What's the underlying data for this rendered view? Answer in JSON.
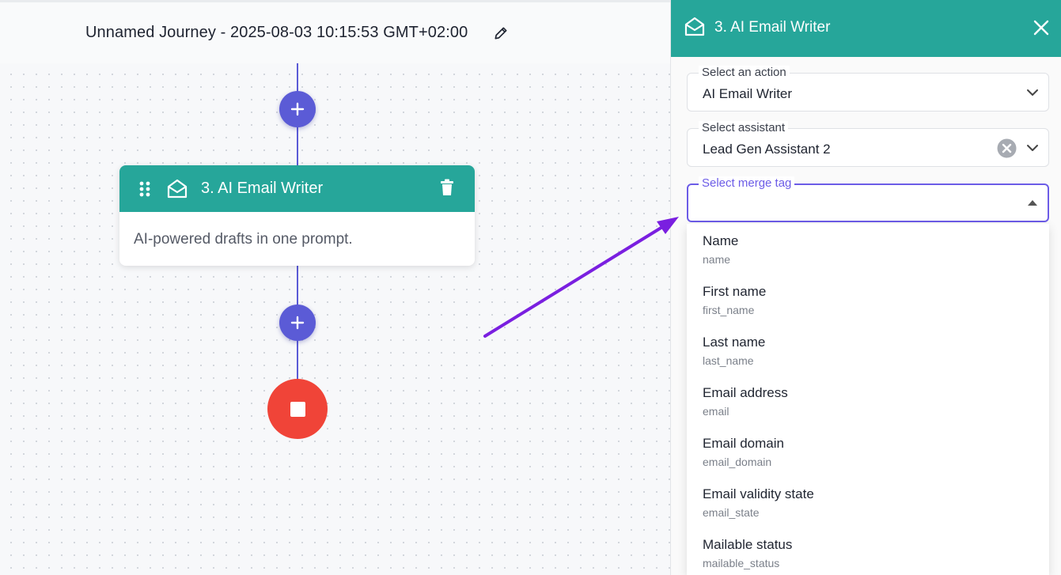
{
  "journey": {
    "title": "Unnamed Journey - 2025-08-03 10:15:53 GMT+02:00"
  },
  "node": {
    "title": "3. AI Email Writer",
    "description": "AI-powered drafts in one prompt."
  },
  "panel": {
    "title": "3. AI Email Writer",
    "action_field": {
      "label": "Select an action",
      "value": "AI Email Writer"
    },
    "assistant_field": {
      "label": "Select assistant",
      "value": "Lead Gen Assistant 2"
    },
    "merge_tag_field": {
      "label": "Select merge tag",
      "value": ""
    },
    "merge_tags": [
      {
        "label": "Name",
        "key": "name"
      },
      {
        "label": "First name",
        "key": "first_name"
      },
      {
        "label": "Last name",
        "key": "last_name"
      },
      {
        "label": "Email address",
        "key": "email"
      },
      {
        "label": "Email domain",
        "key": "email_domain"
      },
      {
        "label": "Email validity state",
        "key": "email_state"
      },
      {
        "label": "Mailable status",
        "key": "mailable_status"
      }
    ]
  },
  "colors": {
    "teal": "#26a69a",
    "indigo": "#5b5bd6",
    "stop_red": "#f04438",
    "focus_purple": "#6c5ce7",
    "annotation_arrow": "#7a1fe0"
  }
}
